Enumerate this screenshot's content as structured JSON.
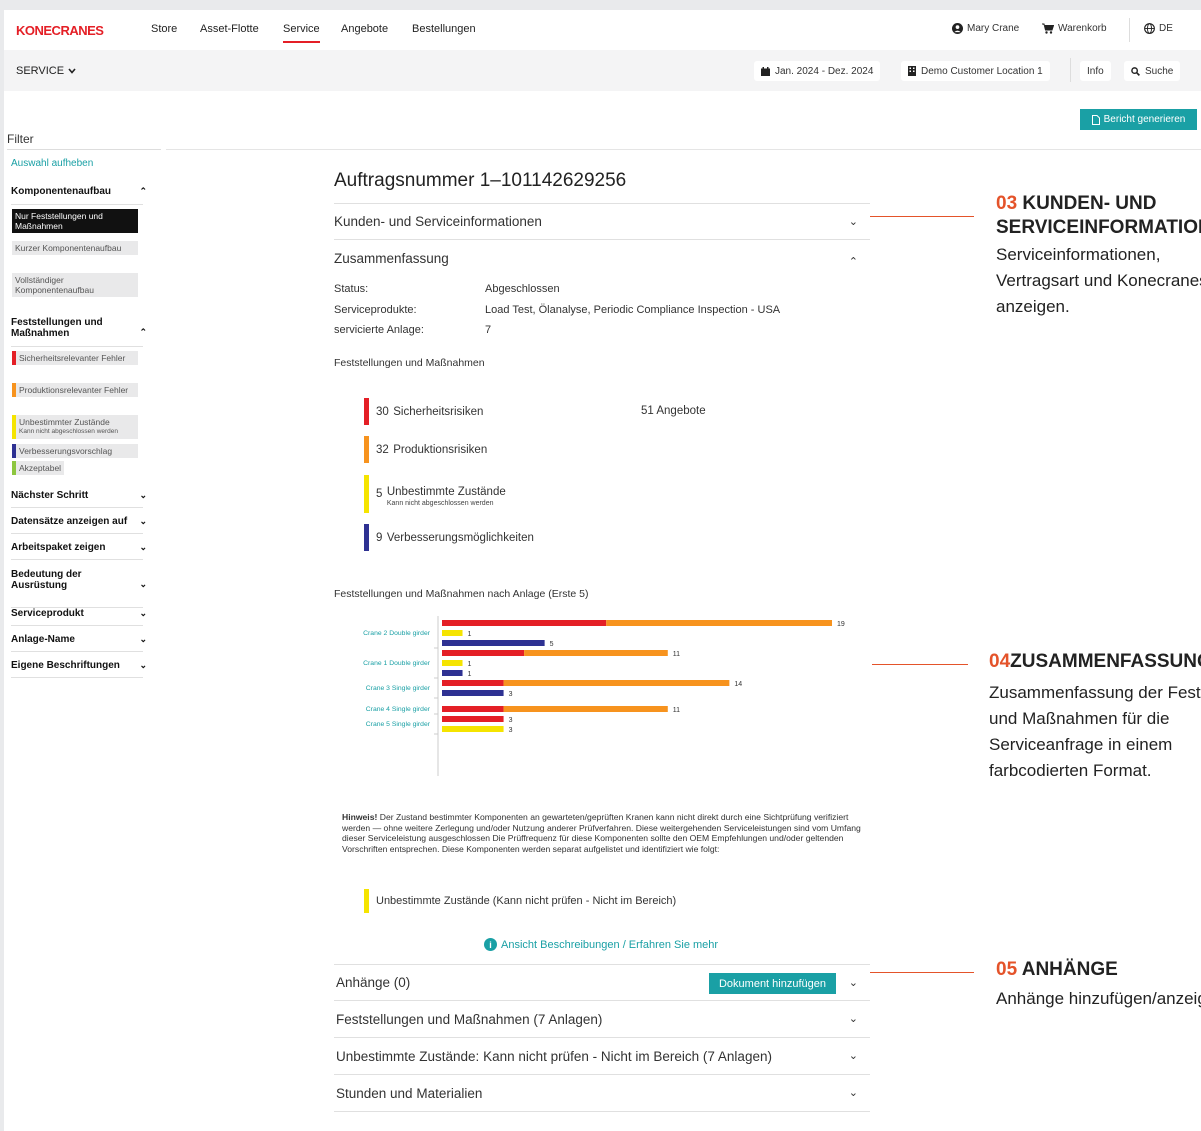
{
  "brand": {
    "logo": "KONECRANES",
    "accent": "#e41f26",
    "teal": "#1aa0a5"
  },
  "nav": {
    "items": [
      "Store",
      "Asset-Flotte",
      "Service",
      "Angebote",
      "Bestellungen"
    ],
    "active": "Service",
    "user": "Mary Crane",
    "cart": "Warenkorb",
    "lang": "DE"
  },
  "subbar": {
    "section": "SERVICE",
    "date_range": "Jan. 2024 - Dez. 2024",
    "location": "Demo Customer Location 1",
    "info": "Info",
    "search": "Suche"
  },
  "report_button": "Bericht generieren",
  "sidebar": {
    "title": "Filter",
    "clear": "Auswahl aufheben",
    "sections": {
      "component": {
        "title": "Komponentenaufbau",
        "options": [
          "Nur Feststellungen und Maßnahmen",
          "Kurzer Komponentenaufbau",
          "Vollständiger Komponentenaufbau"
        ]
      },
      "findings": {
        "title": "Feststellungen und Maßnahmen",
        "options": [
          {
            "label": "Sicherheitsrelevanter Fehler",
            "color": "#e41f26"
          },
          {
            "label": "Produktionsrelevanter Fehler",
            "color": "#f7931e"
          },
          {
            "label": "Unbestimmter Zustände",
            "sub": "Kann nicht abgeschlossen werden",
            "color": "#f5e400"
          },
          {
            "label": "Verbesserungsvorschlag",
            "color": "#2e3192"
          },
          {
            "label": "Akzeptabel",
            "color": "#8dc63f"
          }
        ]
      },
      "collapsed": [
        "Nächster Schritt",
        "Datensätze anzeigen auf",
        "Arbeitspaket zeigen",
        "Bedeutung der Ausrüstung",
        "Serviceprodukt",
        "Anlage-Name",
        "Eigene Beschriftungen"
      ]
    }
  },
  "main": {
    "order_title": "Auftragsnummer 1–101142629256",
    "acc_customer": "Kunden- und Serviceinformationen",
    "acc_summary": "Zusammenfassung",
    "summary": {
      "status_label": "Status:",
      "status_value": "Abgeschlossen",
      "products_label": "Serviceprodukte:",
      "products_value": "Load Test, Ölanalyse, Periodic Compliance Inspection - USA",
      "assets_label": "servicierte Anlage:",
      "assets_value": "7"
    },
    "findings_label": "Feststellungen und Maßnahmen",
    "risks": {
      "safety": {
        "count": "30",
        "label": "Sicherheitsrisiken",
        "color": "#e41f26"
      },
      "production": {
        "count": "32",
        "label": "Produktionsrisiken",
        "color": "#f7931e"
      },
      "unknown": {
        "count": "5",
        "label": "Unbestimmte Zustände",
        "sub": "Kann nicht abgeschlossen werden",
        "color": "#f5e400"
      },
      "improve": {
        "count": "9",
        "label": "Verbesserungsmöglichkeiten",
        "color": "#2e3192"
      },
      "offers": "51 Angebote"
    },
    "chart_label": "Feststellungen und Maßnahmen nach Anlage (Erste 5)",
    "note_bold": "Hinweis!",
    "note_text": " Der Zustand bestimmter Komponenten an gewarteten/geprüften Kranen kann nicht direkt durch eine Sichtprüfung verifiziert werden — ohne weitere Zerlegung und/oder Nutzung anderer Prüfverfahren. Diese weitergehenden Serviceleistungen sind vom Umfang dieser Serviceleistung ausgeschlossen Die Prüffrequenz für diese Komponenten sollte den OEM Empfehlungen und/oder geltenden Vorschriften entsprechen. Diese Komponenten werden separat aufgelistet und identifiziert wie folgt:",
    "unk_legend": "Unbestimmte Zustände (Kann nicht prüfen - Nicht im Bereich)",
    "learn_more": "Ansicht Beschreibungen / Erfahren Sie mehr",
    "acc_attachments": "Anhänge (0)",
    "add_doc": "Dokument hinzufügen",
    "acc_findings": "Feststellungen und Maßnahmen (7 Anlagen)",
    "acc_unknown": "Unbestimmte Zustände: Kann nicht prüfen - Nicht im Bereich (7 Anlagen)",
    "acc_hours": "Stunden und Materialien"
  },
  "chart_data": {
    "type": "bar",
    "orientation": "horizontal-stacked",
    "categories": [
      "Crane 2 Double girder",
      "Crane 1 Double girder",
      "Crane 3 Single girder",
      "Crane 4 Single girder",
      "Crane 5 Single girder"
    ],
    "rows": [
      {
        "category": 0,
        "segments": [
          {
            "color": "#e41f26",
            "value": 8
          },
          {
            "color": "#f7931e",
            "value": 11
          }
        ],
        "label": "19"
      },
      {
        "category": 0,
        "segments": [
          {
            "color": "#f5e400",
            "value": 1
          }
        ],
        "label": "1"
      },
      {
        "category": 0,
        "segments": [
          {
            "color": "#2e3192",
            "value": 5
          }
        ],
        "label": "5"
      },
      {
        "category": 1,
        "segments": [
          {
            "color": "#e41f26",
            "value": 4
          },
          {
            "color": "#f7931e",
            "value": 7
          }
        ],
        "label": "11"
      },
      {
        "category": 1,
        "segments": [
          {
            "color": "#f5e400",
            "value": 1
          }
        ],
        "label": "1"
      },
      {
        "category": 1,
        "segments": [
          {
            "color": "#2e3192",
            "value": 1
          }
        ],
        "label": "1"
      },
      {
        "category": 2,
        "segments": [
          {
            "color": "#e41f26",
            "value": 3
          },
          {
            "color": "#f7931e",
            "value": 11
          }
        ],
        "label": "14"
      },
      {
        "category": 2,
        "segments": [
          {
            "color": "#2e3192",
            "value": 3
          }
        ],
        "label": "3"
      },
      {
        "category": 3,
        "segments": [
          {
            "color": "#e41f26",
            "value": 3
          },
          {
            "color": "#f7931e",
            "value": 8
          }
        ],
        "label": "11"
      },
      {
        "category": 4,
        "segments": [
          {
            "color": "#e41f26",
            "value": 3
          }
        ],
        "label": "3"
      },
      {
        "category": 4,
        "segments": [
          {
            "color": "#f5e400",
            "value": 3
          }
        ],
        "label": "3"
      }
    ],
    "xmax": 19
  },
  "callouts": {
    "c03": {
      "num": "03",
      "title_a": "KUNDEN- UND",
      "title_b": "SERVICEINFORMATIONEN",
      "text_a": "Serviceinformationen,",
      "text_b": "Vertragsart und Konecranes-Kontakt",
      "text_c": "anzeigen."
    },
    "c04": {
      "num": "04",
      "title": "ZUSAMMENFASSUNG",
      "text_a": "Zusammenfassung der Feststellungen",
      "text_b": "und Maßnahmen für die",
      "text_c": "Serviceanfrage in einem",
      "text_d": "farbcodierten Format."
    },
    "c05": {
      "num": "05",
      "title": "ANHÄNGE",
      "text_a": "Anhänge hinzufügen/anzeigen"
    }
  }
}
